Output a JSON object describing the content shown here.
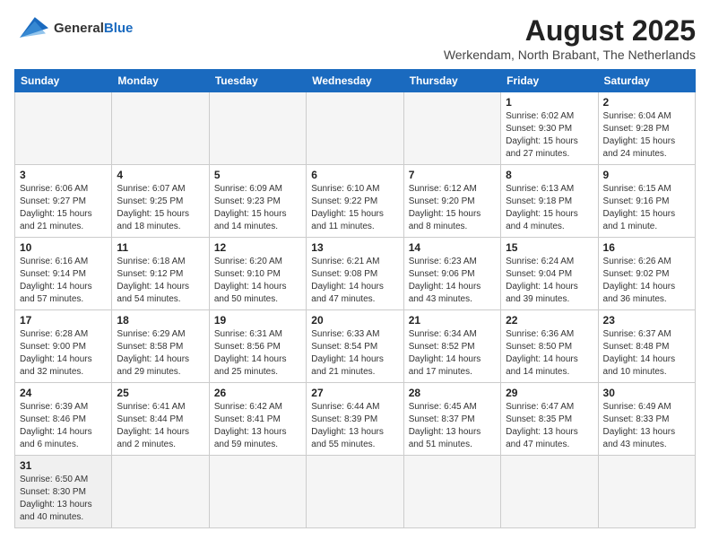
{
  "header": {
    "title": "August 2025",
    "location": "Werkendam, North Brabant, The Netherlands",
    "logo_general": "General",
    "logo_blue": "Blue"
  },
  "weekdays": [
    "Sunday",
    "Monday",
    "Tuesday",
    "Wednesday",
    "Thursday",
    "Friday",
    "Saturday"
  ],
  "weeks": [
    [
      {
        "day": "",
        "info": ""
      },
      {
        "day": "",
        "info": ""
      },
      {
        "day": "",
        "info": ""
      },
      {
        "day": "",
        "info": ""
      },
      {
        "day": "",
        "info": ""
      },
      {
        "day": "1",
        "info": "Sunrise: 6:02 AM\nSunset: 9:30 PM\nDaylight: 15 hours and 27 minutes."
      },
      {
        "day": "2",
        "info": "Sunrise: 6:04 AM\nSunset: 9:28 PM\nDaylight: 15 hours and 24 minutes."
      }
    ],
    [
      {
        "day": "3",
        "info": "Sunrise: 6:06 AM\nSunset: 9:27 PM\nDaylight: 15 hours and 21 minutes."
      },
      {
        "day": "4",
        "info": "Sunrise: 6:07 AM\nSunset: 9:25 PM\nDaylight: 15 hours and 18 minutes."
      },
      {
        "day": "5",
        "info": "Sunrise: 6:09 AM\nSunset: 9:23 PM\nDaylight: 15 hours and 14 minutes."
      },
      {
        "day": "6",
        "info": "Sunrise: 6:10 AM\nSunset: 9:22 PM\nDaylight: 15 hours and 11 minutes."
      },
      {
        "day": "7",
        "info": "Sunrise: 6:12 AM\nSunset: 9:20 PM\nDaylight: 15 hours and 8 minutes."
      },
      {
        "day": "8",
        "info": "Sunrise: 6:13 AM\nSunset: 9:18 PM\nDaylight: 15 hours and 4 minutes."
      },
      {
        "day": "9",
        "info": "Sunrise: 6:15 AM\nSunset: 9:16 PM\nDaylight: 15 hours and 1 minute."
      }
    ],
    [
      {
        "day": "10",
        "info": "Sunrise: 6:16 AM\nSunset: 9:14 PM\nDaylight: 14 hours and 57 minutes."
      },
      {
        "day": "11",
        "info": "Sunrise: 6:18 AM\nSunset: 9:12 PM\nDaylight: 14 hours and 54 minutes."
      },
      {
        "day": "12",
        "info": "Sunrise: 6:20 AM\nSunset: 9:10 PM\nDaylight: 14 hours and 50 minutes."
      },
      {
        "day": "13",
        "info": "Sunrise: 6:21 AM\nSunset: 9:08 PM\nDaylight: 14 hours and 47 minutes."
      },
      {
        "day": "14",
        "info": "Sunrise: 6:23 AM\nSunset: 9:06 PM\nDaylight: 14 hours and 43 minutes."
      },
      {
        "day": "15",
        "info": "Sunrise: 6:24 AM\nSunset: 9:04 PM\nDaylight: 14 hours and 39 minutes."
      },
      {
        "day": "16",
        "info": "Sunrise: 6:26 AM\nSunset: 9:02 PM\nDaylight: 14 hours and 36 minutes."
      }
    ],
    [
      {
        "day": "17",
        "info": "Sunrise: 6:28 AM\nSunset: 9:00 PM\nDaylight: 14 hours and 32 minutes."
      },
      {
        "day": "18",
        "info": "Sunrise: 6:29 AM\nSunset: 8:58 PM\nDaylight: 14 hours and 29 minutes."
      },
      {
        "day": "19",
        "info": "Sunrise: 6:31 AM\nSunset: 8:56 PM\nDaylight: 14 hours and 25 minutes."
      },
      {
        "day": "20",
        "info": "Sunrise: 6:33 AM\nSunset: 8:54 PM\nDaylight: 14 hours and 21 minutes."
      },
      {
        "day": "21",
        "info": "Sunrise: 6:34 AM\nSunset: 8:52 PM\nDaylight: 14 hours and 17 minutes."
      },
      {
        "day": "22",
        "info": "Sunrise: 6:36 AM\nSunset: 8:50 PM\nDaylight: 14 hours and 14 minutes."
      },
      {
        "day": "23",
        "info": "Sunrise: 6:37 AM\nSunset: 8:48 PM\nDaylight: 14 hours and 10 minutes."
      }
    ],
    [
      {
        "day": "24",
        "info": "Sunrise: 6:39 AM\nSunset: 8:46 PM\nDaylight: 14 hours and 6 minutes."
      },
      {
        "day": "25",
        "info": "Sunrise: 6:41 AM\nSunset: 8:44 PM\nDaylight: 14 hours and 2 minutes."
      },
      {
        "day": "26",
        "info": "Sunrise: 6:42 AM\nSunset: 8:41 PM\nDaylight: 13 hours and 59 minutes."
      },
      {
        "day": "27",
        "info": "Sunrise: 6:44 AM\nSunset: 8:39 PM\nDaylight: 13 hours and 55 minutes."
      },
      {
        "day": "28",
        "info": "Sunrise: 6:45 AM\nSunset: 8:37 PM\nDaylight: 13 hours and 51 minutes."
      },
      {
        "day": "29",
        "info": "Sunrise: 6:47 AM\nSunset: 8:35 PM\nDaylight: 13 hours and 47 minutes."
      },
      {
        "day": "30",
        "info": "Sunrise: 6:49 AM\nSunset: 8:33 PM\nDaylight: 13 hours and 43 minutes."
      }
    ],
    [
      {
        "day": "31",
        "info": "Sunrise: 6:50 AM\nSunset: 8:30 PM\nDaylight: 13 hours and 40 minutes."
      },
      {
        "day": "",
        "info": ""
      },
      {
        "day": "",
        "info": ""
      },
      {
        "day": "",
        "info": ""
      },
      {
        "day": "",
        "info": ""
      },
      {
        "day": "",
        "info": ""
      },
      {
        "day": "",
        "info": ""
      }
    ]
  ]
}
